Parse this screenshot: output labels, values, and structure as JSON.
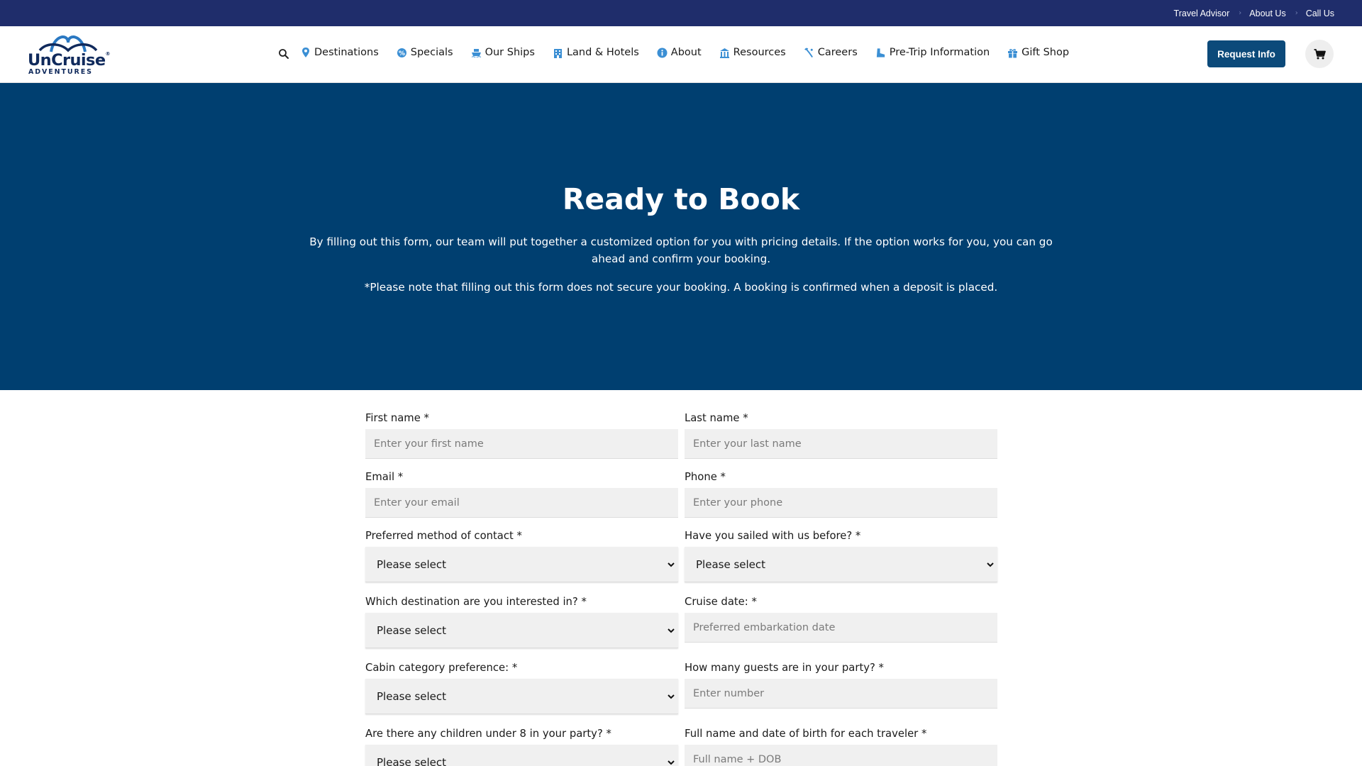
{
  "utility_bar": {
    "links": [
      "Travel Advisor",
      "About Us",
      "Call Us"
    ],
    "separator": "›"
  },
  "header": {
    "logo": {
      "wordmark": "UnCruise",
      "registered": "®",
      "subtitle": "ADVENTURES"
    },
    "nav": [
      {
        "label": "Destinations",
        "icon": "map-pin-icon"
      },
      {
        "label": "Specials",
        "icon": "tag-icon"
      },
      {
        "label": "Our Ships",
        "icon": "ship-icon"
      },
      {
        "label": "Land & Hotels",
        "icon": "hotel-icon"
      },
      {
        "label": "About",
        "icon": "info-icon"
      },
      {
        "label": "Resources",
        "icon": "resources-icon"
      },
      {
        "label": "Careers",
        "icon": "careers-icon"
      },
      {
        "label": "Pre-Trip Information",
        "icon": "boot-icon"
      },
      {
        "label": "Gift Shop",
        "icon": "gift-icon"
      }
    ],
    "request_button": "Request Info",
    "cart_icon": "cart-icon",
    "search_icon": "search-icon"
  },
  "hero": {
    "title": "Ready to Book",
    "text": "By filling out this form, our team will put together a customized option for you with pricing details. If the option works for you, you can go ahead and confirm your booking.",
    "note": "*Please note that filling out this form does not secure your booking. A booking is confirmed when a deposit is placed."
  },
  "form": {
    "first_name": {
      "label": "First name *",
      "placeholder": "Enter your first name"
    },
    "last_name": {
      "label": "Last name *",
      "placeholder": "Enter your last name"
    },
    "email": {
      "label": "Email *",
      "placeholder": "Enter your email"
    },
    "phone": {
      "label": "Phone *",
      "placeholder": "Enter your phone"
    },
    "contact_method": {
      "label": "Preferred method of contact *",
      "value": "Please select"
    },
    "sailed_before": {
      "label": "Have you sailed with us before? *",
      "value": "Please select"
    },
    "destination": {
      "label": "Which destination are you interested in? *",
      "value": "Please select"
    },
    "cruise_date": {
      "label": "Cruise date: *",
      "placeholder": "Preferred embarkation date"
    },
    "cabin_category": {
      "label": "Cabin category preference: *",
      "value": "Please select"
    },
    "guests": {
      "label": "How many guests are in your party? *",
      "placeholder": "Enter number"
    },
    "children": {
      "label": "Are there any children under 8 in your party? *",
      "value": "Please select"
    },
    "travelers": {
      "label": "Full name and date of birth for each traveler *",
      "placeholder": "Full name + DOB"
    }
  },
  "colors": {
    "utility_bar": "#1f2d6b",
    "hero": "#003f70",
    "button": "#0c4a7a",
    "icon_blue": "#3b8fd4",
    "input_bg": "#f0f0f0"
  }
}
